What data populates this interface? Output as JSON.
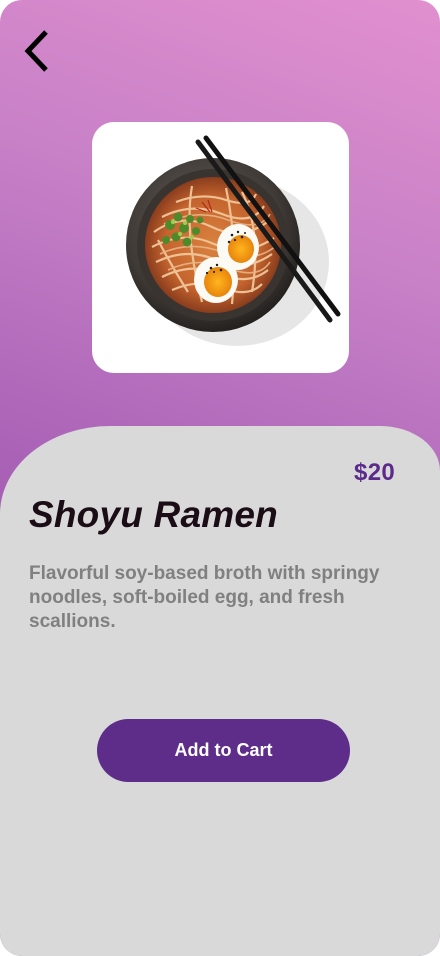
{
  "product": {
    "name": "Shoyu Ramen",
    "price": "$20",
    "description": "Flavorful soy-based broth with springy noodles, soft-boiled egg, and fresh scallions.",
    "image": "ramen-bowl-image"
  },
  "actions": {
    "back_icon": "chevron-left-icon",
    "add_to_cart_label": "Add to Cart"
  },
  "colors": {
    "gradient_top": "#e190cf",
    "gradient_bottom": "#9550aa",
    "sheet": "#d9d9d9",
    "accent": "#5e2d8a",
    "price": "#5b2a8b",
    "title": "#1a0d15",
    "description": "#808080"
  }
}
